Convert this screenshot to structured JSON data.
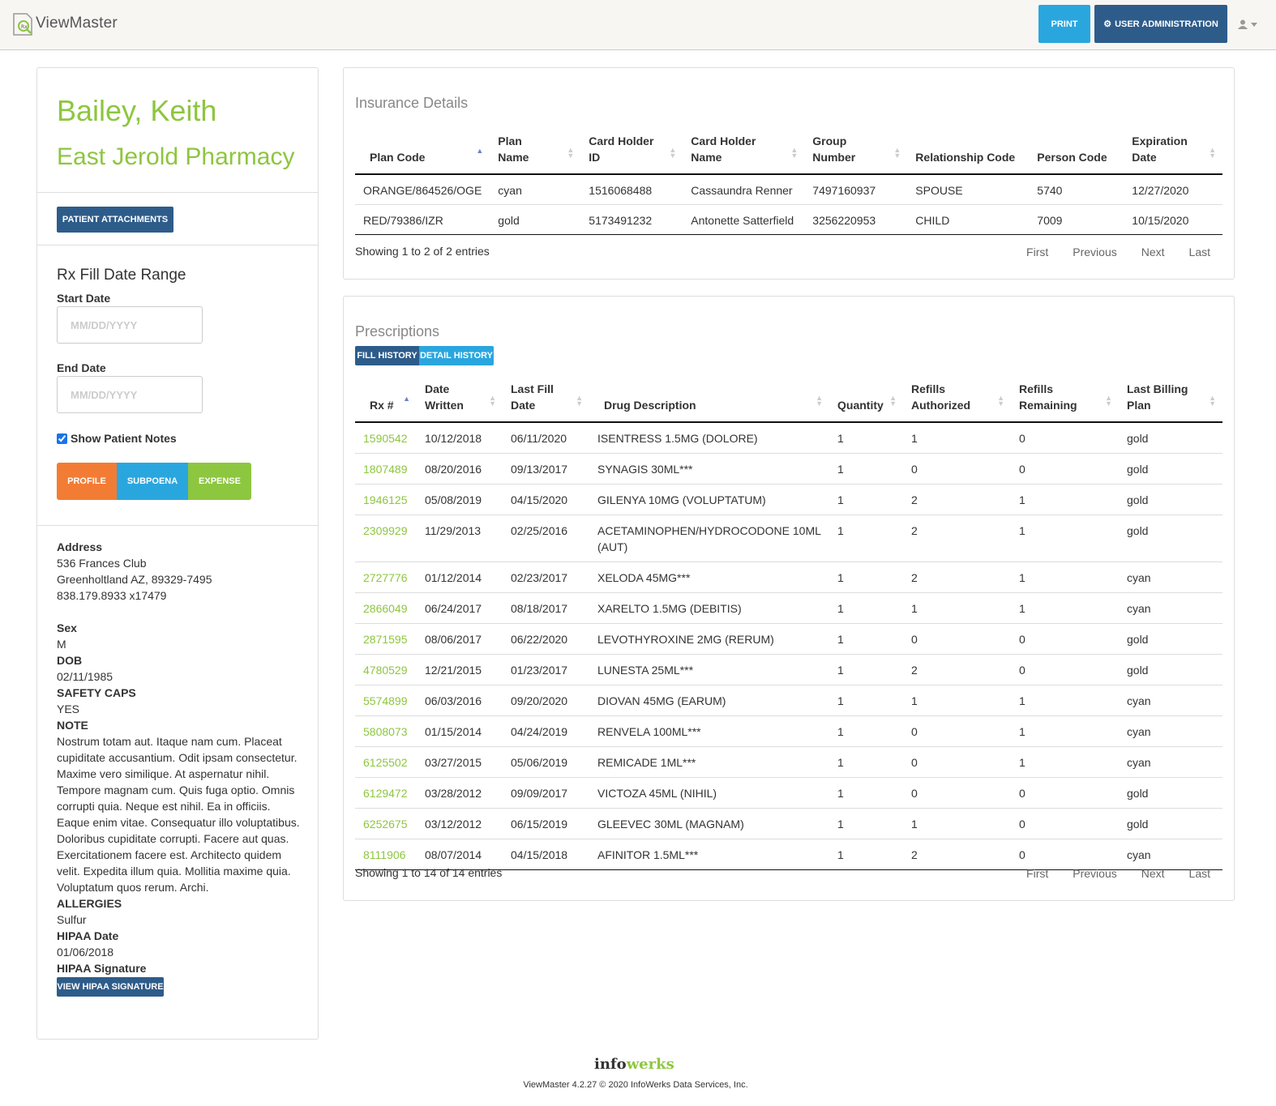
{
  "app": {
    "name": "ViewMaster",
    "print_label": "PRINT",
    "admin_label": "USER ADMINISTRATION"
  },
  "patient": {
    "name": "Bailey, Keith",
    "pharmacy": "East Jerold Pharmacy",
    "attachments_label": "PATIENT ATTACHMENTS",
    "range_title": "Rx Fill Date Range",
    "start_label": "Start Date",
    "end_label": "End Date",
    "date_placeholder": "MM/DD/YYYY",
    "show_notes_label": "Show Patient Notes",
    "show_notes_checked": true,
    "profile_label": "PROFILE",
    "subpoena_label": "SUBPOENA",
    "expense_label": "EXPENSE",
    "address_label": "Address",
    "address_line1": "536 Frances Club",
    "address_line2": "Greenholtland AZ, 89329-7495",
    "phone": "838.179.8933 x17479",
    "sex_label": "Sex",
    "sex": "M",
    "dob_label": "DOB",
    "dob": "02/11/1985",
    "safety_caps_label": "SAFETY CAPS",
    "safety_caps": "YES",
    "note_label": "NOTE",
    "note": "Nostrum totam aut. Itaque nam cum. Placeat cupiditate accusantium. Odit ipsam consectetur. Maxime vero similique. At aspernatur nihil. Tempore magnam cum. Quis fuga optio. Omnis corrupti quia. Neque est nihil. Ea in officiis. Eaque enim vitae. Consequatur illo voluptatibus. Doloribus cupiditate corrupti. Facere aut quas. Exercitationem facere est. Architecto quidem velit. Expedita illum quia. Mollitia maxime quia. Voluptatum quos rerum. Archi.",
    "allergies_label": "ALLERGIES",
    "allergies": "Sulfur",
    "hipaa_date_label": "HIPAA Date",
    "hipaa_date": "01/06/2018",
    "hipaa_sig_label": "HIPAA Signature",
    "hipaa_button": "VIEW HIPAA SIGNATURE"
  },
  "insurance": {
    "title": "Insurance Details",
    "columns": [
      "Plan Code",
      "Plan Name",
      "Card Holder ID",
      "Card Holder Name",
      "Group Number",
      "Relationship Code",
      "Person Code",
      "Expiration Date"
    ],
    "rows": [
      [
        "ORANGE/864526/OGE",
        "cyan",
        "1516068488",
        "Cassaundra Renner",
        "7497160937",
        "SPOUSE",
        "5740",
        "12/27/2020"
      ],
      [
        "RED/79386/IZR",
        "gold",
        "5173491232",
        "Antonette Satterfield",
        "3256220953",
        "CHILD",
        "7009",
        "10/15/2020"
      ]
    ],
    "showing": "Showing 1 to 2 of 2 entries"
  },
  "prescriptions": {
    "title": "Prescriptions",
    "tab_fill": "FILL HISTORY",
    "tab_detail": "DETAIL HISTORY",
    "columns": [
      "Rx #",
      "Date Written",
      "Last Fill Date",
      "Drug Description",
      "Quantity",
      "Refills Authorized",
      "Refills Remaining",
      "Last Billing Plan"
    ],
    "rows": [
      [
        "1590542",
        "10/12/2018",
        "06/11/2020",
        "ISENTRESS 1.5MG (DOLORE)",
        "1",
        "1",
        "0",
        "gold"
      ],
      [
        "1807489",
        "08/20/2016",
        "09/13/2017",
        "SYNAGIS 30ML***",
        "1",
        "0",
        "0",
        "gold"
      ],
      [
        "1946125",
        "05/08/2019",
        "04/15/2020",
        "GILENYA 10MG (VOLUPTATUM)",
        "1",
        "2",
        "1",
        "gold"
      ],
      [
        "2309929",
        "11/29/2013",
        "02/25/2016",
        "ACETAMINOPHEN/HYDROCODONE 10ML (AUT)",
        "1",
        "2",
        "1",
        "gold"
      ],
      [
        "2727776",
        "01/12/2014",
        "02/23/2017",
        "XELODA 45MG***",
        "1",
        "2",
        "1",
        "cyan"
      ],
      [
        "2866049",
        "06/24/2017",
        "08/18/2017",
        "XARELTO 1.5MG (DEBITIS)",
        "1",
        "1",
        "1",
        "cyan"
      ],
      [
        "2871595",
        "08/06/2017",
        "06/22/2020",
        "LEVOTHYROXINE 2MG (RERUM)",
        "1",
        "0",
        "0",
        "gold"
      ],
      [
        "4780529",
        "12/21/2015",
        "01/23/2017",
        "LUNESTA 25ML***",
        "1",
        "2",
        "0",
        "gold"
      ],
      [
        "5574899",
        "06/03/2016",
        "09/20/2020",
        "DIOVAN 45MG (EARUM)",
        "1",
        "1",
        "1",
        "cyan"
      ],
      [
        "5808073",
        "01/15/2014",
        "04/24/2019",
        "RENVELA 100ML***",
        "1",
        "0",
        "1",
        "cyan"
      ],
      [
        "6125502",
        "03/27/2015",
        "05/06/2019",
        "REMICADE 1ML***",
        "1",
        "0",
        "1",
        "cyan"
      ],
      [
        "6129472",
        "03/28/2012",
        "09/09/2017",
        "VICTOZA 45ML (NIHIL)",
        "1",
        "0",
        "0",
        "gold"
      ],
      [
        "6252675",
        "03/12/2012",
        "06/15/2019",
        "GLEEVEC 30ML (MAGNAM)",
        "1",
        "1",
        "0",
        "gold"
      ],
      [
        "8111906",
        "08/07/2014",
        "04/15/2018",
        "AFINITOR 1.5ML***",
        "1",
        "2",
        "0",
        "cyan"
      ]
    ],
    "showing": "Showing 1 to 14 of 14 entries"
  },
  "pager": {
    "first": "First",
    "previous": "Previous",
    "next": "Next",
    "last": "Last"
  },
  "footer": {
    "brand_a": "info",
    "brand_b": "werks",
    "text": "ViewMaster 4.2.27 © 2020 InfoWerks Data Services, Inc."
  }
}
